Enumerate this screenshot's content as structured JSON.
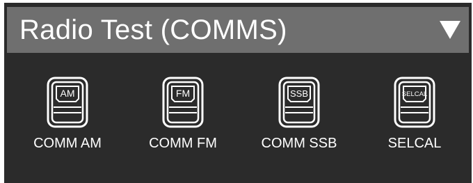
{
  "header": {
    "title": "Radio Test (COMMS)",
    "dropdown_icon": "triangle-down-icon"
  },
  "items": [
    {
      "name": "comm-am",
      "icon_text": "AM",
      "label": "COMM AM",
      "icon": "radio-panel-icon"
    },
    {
      "name": "comm-fm",
      "icon_text": "FM",
      "label": "COMM FM",
      "icon": "radio-panel-icon"
    },
    {
      "name": "comm-ssb",
      "icon_text": "SSB",
      "label": "COMM SSB",
      "icon": "radio-panel-icon"
    },
    {
      "name": "selcal",
      "icon_text": "SELCAL",
      "label": "SELCAL",
      "icon": "radio-panel-icon"
    }
  ],
  "colors": {
    "panel_bg": "#2b2b2b",
    "header_bg": "#6f6f6f",
    "text": "#ffffff"
  }
}
